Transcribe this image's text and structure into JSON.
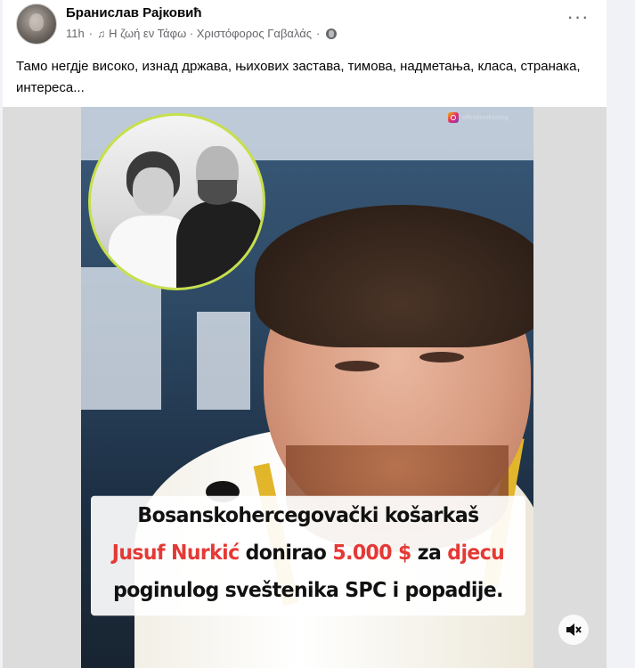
{
  "post": {
    "author": "Бранислав Рајковић",
    "time": "11h",
    "music_icon": "music-note-icon",
    "song": "Η ζωή εν Τάφω · Χριστόφορος Γαβαλάς",
    "privacy_icon": "globe-icon",
    "more_icon": "three-dots-icon",
    "text": "Тамо негдје високо, изнад држава, њихових застава, тимова, надметања, класа, странака, интереса..."
  },
  "media": {
    "instagram_handle": "officialnurkicblog",
    "caption": {
      "line1": "Bosanskohercegovački košarkaš",
      "name": "Jusuf Nurkić",
      "donated": "donirao",
      "amount": "5.000 $",
      "for": "za",
      "children": "djecu",
      "line3": "poginulog sveštenika SPC i popadije."
    },
    "mute_icon": "speaker-muted-icon",
    "accent_color": "#e53935",
    "ring_color": "#c6e04a"
  }
}
